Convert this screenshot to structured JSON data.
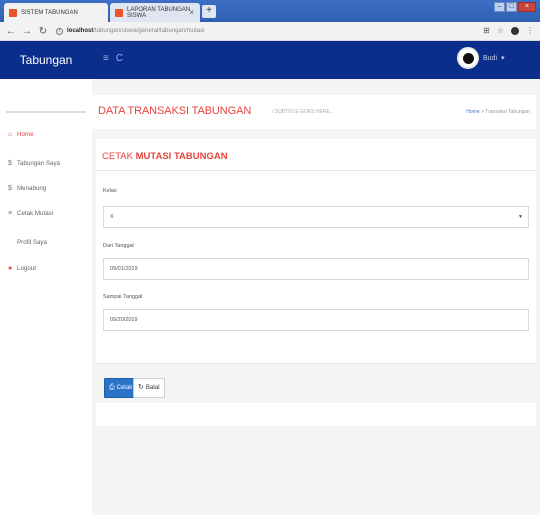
{
  "browser": {
    "tabs": [
      {
        "title": "SISTEM TABUNGAN",
        "active": true
      },
      {
        "title": "LAPORAN TABUNGAN SISWA",
        "active": false
      }
    ],
    "new_tab": "+",
    "url_host": "localhost",
    "url_path": "/tabungan/siswa/general/tabungan/mutasi"
  },
  "header": {
    "brand": "Tabungan",
    "user_name": "Budi"
  },
  "sidebar": {
    "items": [
      {
        "label": "Home",
        "icon": "home-icon",
        "glyph": "⌂",
        "active": true
      },
      {
        "label": "Tabungan Saya",
        "icon": "dollar-icon",
        "glyph": "$",
        "active": false
      },
      {
        "label": "Menabung",
        "icon": "dollar-icon",
        "glyph": "$",
        "active": false
      },
      {
        "label": "Cetak Mutasi",
        "icon": "list-icon",
        "glyph": "≡",
        "active": false
      },
      {
        "label": "Profil Saya",
        "icon": "",
        "glyph": "",
        "active": false
      },
      {
        "label": "Logout",
        "icon": "power-icon",
        "glyph": "●",
        "active": false
      }
    ]
  },
  "page": {
    "title": "DATA TRANSAKSI TABUNGAN",
    "subtitle": "/  SUBTITLE GOES HERE...",
    "breadcrumb_home": "Home",
    "breadcrumb_sep": ">",
    "breadcrumb_current": "Transaksi Tabungan"
  },
  "card": {
    "title_prefix": "CETAK ",
    "title_bold": "MUTASI TABUNGAN",
    "fields": {
      "kelas_label": "Kelas",
      "kelas_value": "X",
      "dari_label": "Dari Tanggal",
      "dari_value": "09/01/2019",
      "sampai_label": "Sampai Tanggal",
      "sampai_value": "09/20/2019"
    }
  },
  "actions": {
    "cetak_label": "Cetak",
    "batal_label": "Batal"
  },
  "colors": {
    "header_bg": "#0b2d8c",
    "accent": "#e8443e",
    "primary_button": "#2b73c9"
  }
}
